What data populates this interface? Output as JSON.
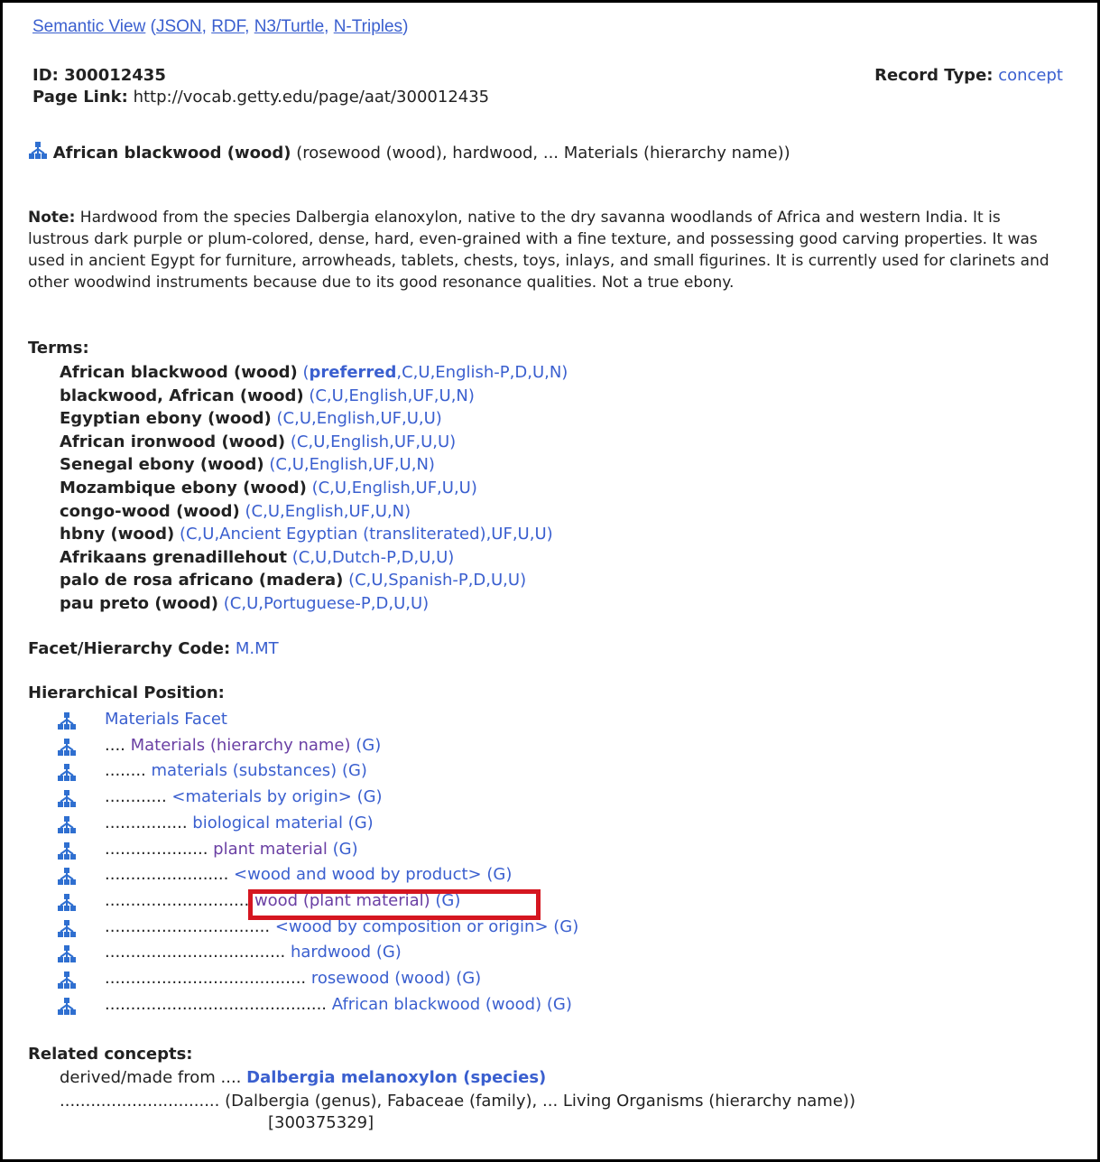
{
  "nav": {
    "semantic_view": "Semantic View",
    "open_paren": "(",
    "json": "JSON",
    "sep1": ", ",
    "rdf": "RDF",
    "sep2": ", ",
    "turtle": "N3/Turtle",
    "sep3": ", ",
    "ntriples": "N-Triples",
    "close_paren": ")"
  },
  "record": {
    "id_label": "ID:",
    "id_value": "300012435",
    "page_link_label": "Page Link:",
    "page_link_value": "http://vocab.getty.edu/page/aat/300012435",
    "record_type_label": "Record Type:",
    "record_type_value": "concept"
  },
  "headline": {
    "term": "African blackwood (wood)",
    "context": "(rosewood (wood), hardwood, ... Materials (hierarchy name))"
  },
  "note": {
    "label": "Note:",
    "text": "Hardwood from the species Dalbergia elanoxylon, native to the dry savanna woodlands of Africa and western India. It is lustrous dark purple or plum-colored, dense, hard, even-grained with a fine texture, and possessing good carving properties. It was used in ancient Egypt for furniture, arrowheads, tablets, chests, toys, inlays, and small figurines. It is currently used for clarinets and other woodwind instruments because due to its good resonance qualities. Not a true ebony."
  },
  "terms": {
    "label": "Terms:",
    "items": [
      {
        "term": "African blackwood (wood)",
        "pref": "preferred",
        "flags": ",C,U,English-P,D,U,N)"
      },
      {
        "term": "blackwood, African (wood)",
        "pref": "",
        "flags": "(C,U,English,UF,U,N)"
      },
      {
        "term": "Egyptian ebony (wood)",
        "pref": "",
        "flags": "(C,U,English,UF,U,U)"
      },
      {
        "term": "African ironwood (wood)",
        "pref": "",
        "flags": "(C,U,English,UF,U,U)"
      },
      {
        "term": "Senegal ebony (wood)",
        "pref": "",
        "flags": "(C,U,English,UF,U,N)"
      },
      {
        "term": "Mozambique ebony (wood)",
        "pref": "",
        "flags": "(C,U,English,UF,U,U)"
      },
      {
        "term": "congo-wood (wood)",
        "pref": "",
        "flags": "(C,U,English,UF,U,N)"
      },
      {
        "term": "hbny (wood)",
        "pref": "",
        "flags": "(C,U,Ancient Egyptian (transliterated),UF,U,U)"
      },
      {
        "term": "Afrikaans grenadillehout",
        "pref": "",
        "flags": "(C,U,Dutch-P,D,U,U)"
      },
      {
        "term": "palo de rosa africano (madera)",
        "pref": "",
        "flags": "(C,U,Spanish-P,D,U,U)"
      },
      {
        "term": "pau preto (wood)",
        "pref": "",
        "flags": "(C,U,Portuguese-P,D,U,U)"
      }
    ]
  },
  "facet": {
    "label": "Facet/Hierarchy Code:",
    "value": "M.MT"
  },
  "hierarchy": {
    "label": "Hierarchical Position:",
    "items": [
      {
        "dots": "",
        "name": "Materials Facet",
        "g": ""
      },
      {
        "dots": ".... ",
        "name": "Materials (hierarchy name)",
        "g": " (G)"
      },
      {
        "dots": "........ ",
        "name": "materials (substances)",
        "g": " (G)"
      },
      {
        "dots": "............ ",
        "name": "<materials by origin>",
        "g": " (G)"
      },
      {
        "dots": "................ ",
        "name": "biological material",
        "g": " (G)"
      },
      {
        "dots": ".................... ",
        "name": "plant material",
        "g": " (G)"
      },
      {
        "dots": "........................ ",
        "name": "<wood and wood by product>",
        "g": " (G)"
      },
      {
        "dots": "............................ ",
        "name": "wood (plant material)",
        "g": " (G)"
      },
      {
        "dots": "................................ ",
        "name": "<wood by composition or origin>",
        "g": " (G)"
      },
      {
        "dots": "................................... ",
        "name": "hardwood",
        "g": " (G)"
      },
      {
        "dots": "....................................... ",
        "name": "rosewood (wood)",
        "g": " (G)"
      },
      {
        "dots": "........................................... ",
        "name": "African blackwood (wood)",
        "g": " (G)"
      }
    ]
  },
  "related": {
    "label": "Related concepts:",
    "relation": "derived/made from ....",
    "target": "Dalbergia melanoxylon (species)",
    "dots": "...............................",
    "context": "(Dalbergia (genus), Fabaceae (family), ... Living Organisms (hierarchy name))",
    "id": "[300375329]"
  },
  "colors": {
    "link": "#3a5fcf",
    "visited": "#6a3fa3",
    "highlight_box": "#d51620"
  },
  "icons": {
    "hierarchy": "hierarchy-tree-icon"
  }
}
